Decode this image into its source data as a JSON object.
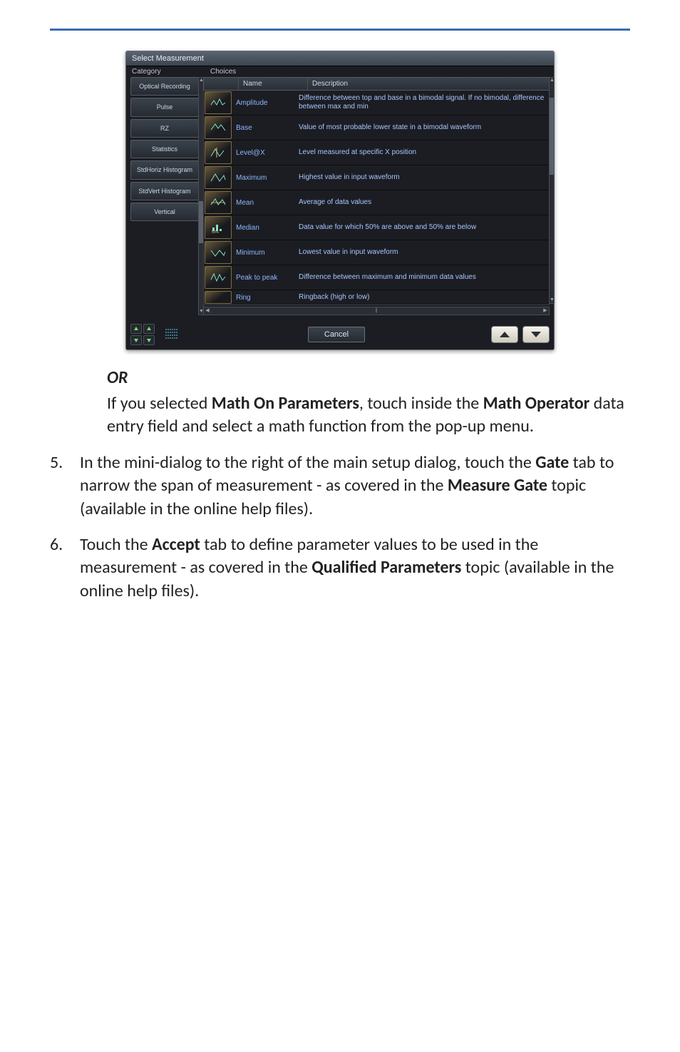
{
  "dialog": {
    "title": "Select Measurement",
    "label_category": "Category",
    "label_choices": "Choices",
    "categories": [
      "Optical Recording",
      "Pulse",
      "RZ",
      "Statistics",
      "StdHoriz Histogram",
      "StdVert Histogram",
      "Vertical"
    ],
    "header": {
      "name": "Name",
      "description": "Description"
    },
    "rows": [
      {
        "name": "Amplitude",
        "desc": "Difference between top and base in a bimodal signal. If no bimodal, difference between max and min"
      },
      {
        "name": "Base",
        "desc": "Value of most probable lower state in a bimodal waveform"
      },
      {
        "name": "Level@X",
        "desc": "Level measured at specific X position"
      },
      {
        "name": "Maximum",
        "desc": "Highest value in input waveform"
      },
      {
        "name": "Mean",
        "desc": "Average of data values"
      },
      {
        "name": "Median",
        "desc": "Data value for which 50% are above and 50% are below"
      },
      {
        "name": "Minimum",
        "desc": "Lowest value in input waveform"
      },
      {
        "name": "Peak to peak",
        "desc": "Difference between maximum and minimum data values"
      },
      {
        "name": "Ring",
        "desc": "Ringback (high or low)"
      }
    ],
    "cancel": "Cancel"
  },
  "doc": {
    "or": "OR",
    "mathpara_pre": "If you selected ",
    "mathpara_b1": "Math On Parameters",
    "mathpara_mid1": ", touch inside the ",
    "mathpara_b2": "Math Operator",
    "mathpara_post": " data entry field and select a math function from the pop-up menu.",
    "item5_num": "5.",
    "item5_pre": "In the mini-dialog to the right of the main setup dialog, touch the ",
    "item5_b1": "Gate",
    "item5_mid1": " tab to narrow the span of measurement - as covered in the ",
    "item5_b2": "Measure Gate",
    "item5_post": " topic (available in the online help files).",
    "item6_num": "6.",
    "item6_pre": "Touch the ",
    "item6_b1": "Accept",
    "item6_mid1": " tab to define parameter values to be used in the measurement - as covered in the ",
    "item6_b2": "Qualified Parameters",
    "item6_post": " topic (available in the online help files)."
  }
}
